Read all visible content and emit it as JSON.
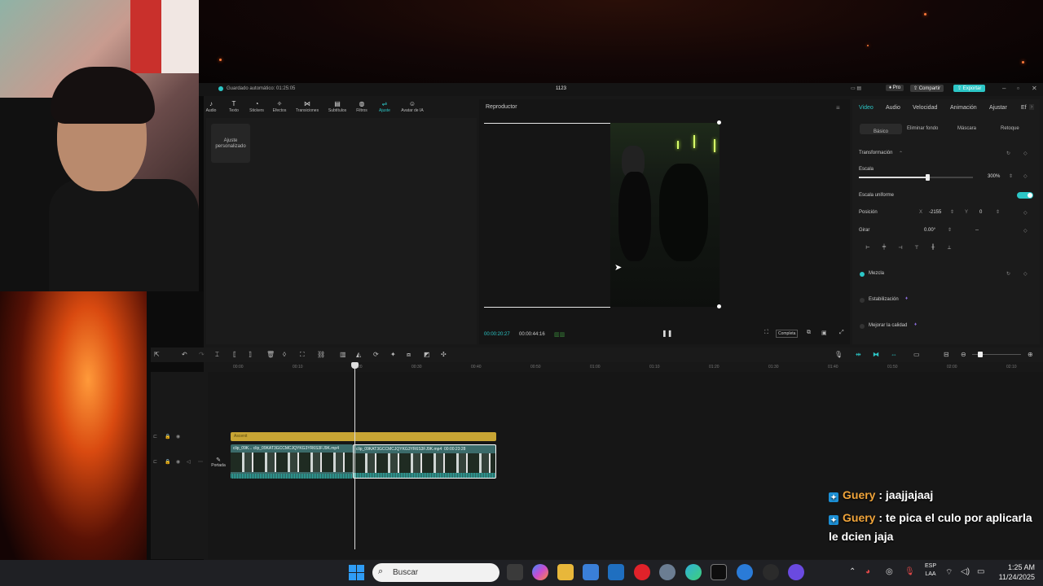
{
  "window": {
    "autosave": "Guardado automático: 01:25:05",
    "title": "1123",
    "pro": "Pro",
    "share": "Compartir",
    "export": "Exportar"
  },
  "toolbar": {
    "items": [
      {
        "label": "Audio",
        "icon": "music-note-icon"
      },
      {
        "label": "Texto",
        "icon": "text-icon"
      },
      {
        "label": "Stickers",
        "icon": "sticker-icon"
      },
      {
        "label": "Efectos",
        "icon": "effects-icon"
      },
      {
        "label": "Transiciones",
        "icon": "transition-icon"
      },
      {
        "label": "Subtítulos",
        "icon": "subtitles-icon"
      },
      {
        "label": "Filtros",
        "icon": "filter-icon"
      },
      {
        "label": "Ajuste",
        "icon": "adjust-icon"
      },
      {
        "label": "Avatar de IA",
        "icon": "avatar-icon"
      }
    ]
  },
  "left_panel": {
    "custom_adjust": "Ajuste personalizado"
  },
  "player": {
    "title": "Reproductor",
    "time_current": "00:00:20:27",
    "time_total": "00:00:44:16",
    "ratio_label": "Completa"
  },
  "right_panel": {
    "tabs": [
      "Video",
      "Audio",
      "Velocidad",
      "Animación",
      "Ajustar",
      "Ef"
    ],
    "subtabs": [
      "Básico",
      "Eliminar fondo",
      "Máscara",
      "Retoque"
    ],
    "transform_label": "Transformación",
    "scale_label": "Escala",
    "scale_value": "300%",
    "scale_level": 0.6,
    "uniform_label": "Escala uniforme",
    "position_label": "Posición",
    "pos_x_label": "X",
    "pos_x": "-2155",
    "pos_y_label": "Y",
    "pos_y": "0",
    "rotate_label": "Girar",
    "rotate_value": "0.00°",
    "rotate_extra": "--",
    "mix_label": "Mezcla",
    "stabilize_label": "Estabilización",
    "quality_label": "Mejorar la calidad"
  },
  "timeline": {
    "ticks": [
      "00:00",
      "00:10",
      "00:20",
      "00:30",
      "00:40",
      "00:50",
      "01:00",
      "01:10",
      "01:20",
      "01:30",
      "01:40",
      "01:50",
      "02:00",
      "02:10"
    ],
    "audio_label": "Ascenit",
    "clip1_label": "clip_09K...",
    "clip1_file": "clip_09KAT3GCCMCJQYKG3YR6S3FJ9K.mp4",
    "clip2_file": "clip_09KAT3GCCMCJQYKG3YR6S3FJ9K.mp4",
    "clip2_duration": "00:00:23:28",
    "cover_label": "Portada"
  },
  "chat": [
    {
      "user": "Guery",
      "sep": " : ",
      "text": "jaajjajaaj"
    },
    {
      "user": "Guery",
      "sep": " : ",
      "text": "te pica el culo por aplicarla",
      "text2": "le dcien jaja"
    }
  ],
  "taskbar": {
    "search_placeholder": "Buscar",
    "lang_top": "ESP",
    "lang_bottom": "LAA",
    "time": "1:25 AM",
    "date": "11/24/2025"
  }
}
